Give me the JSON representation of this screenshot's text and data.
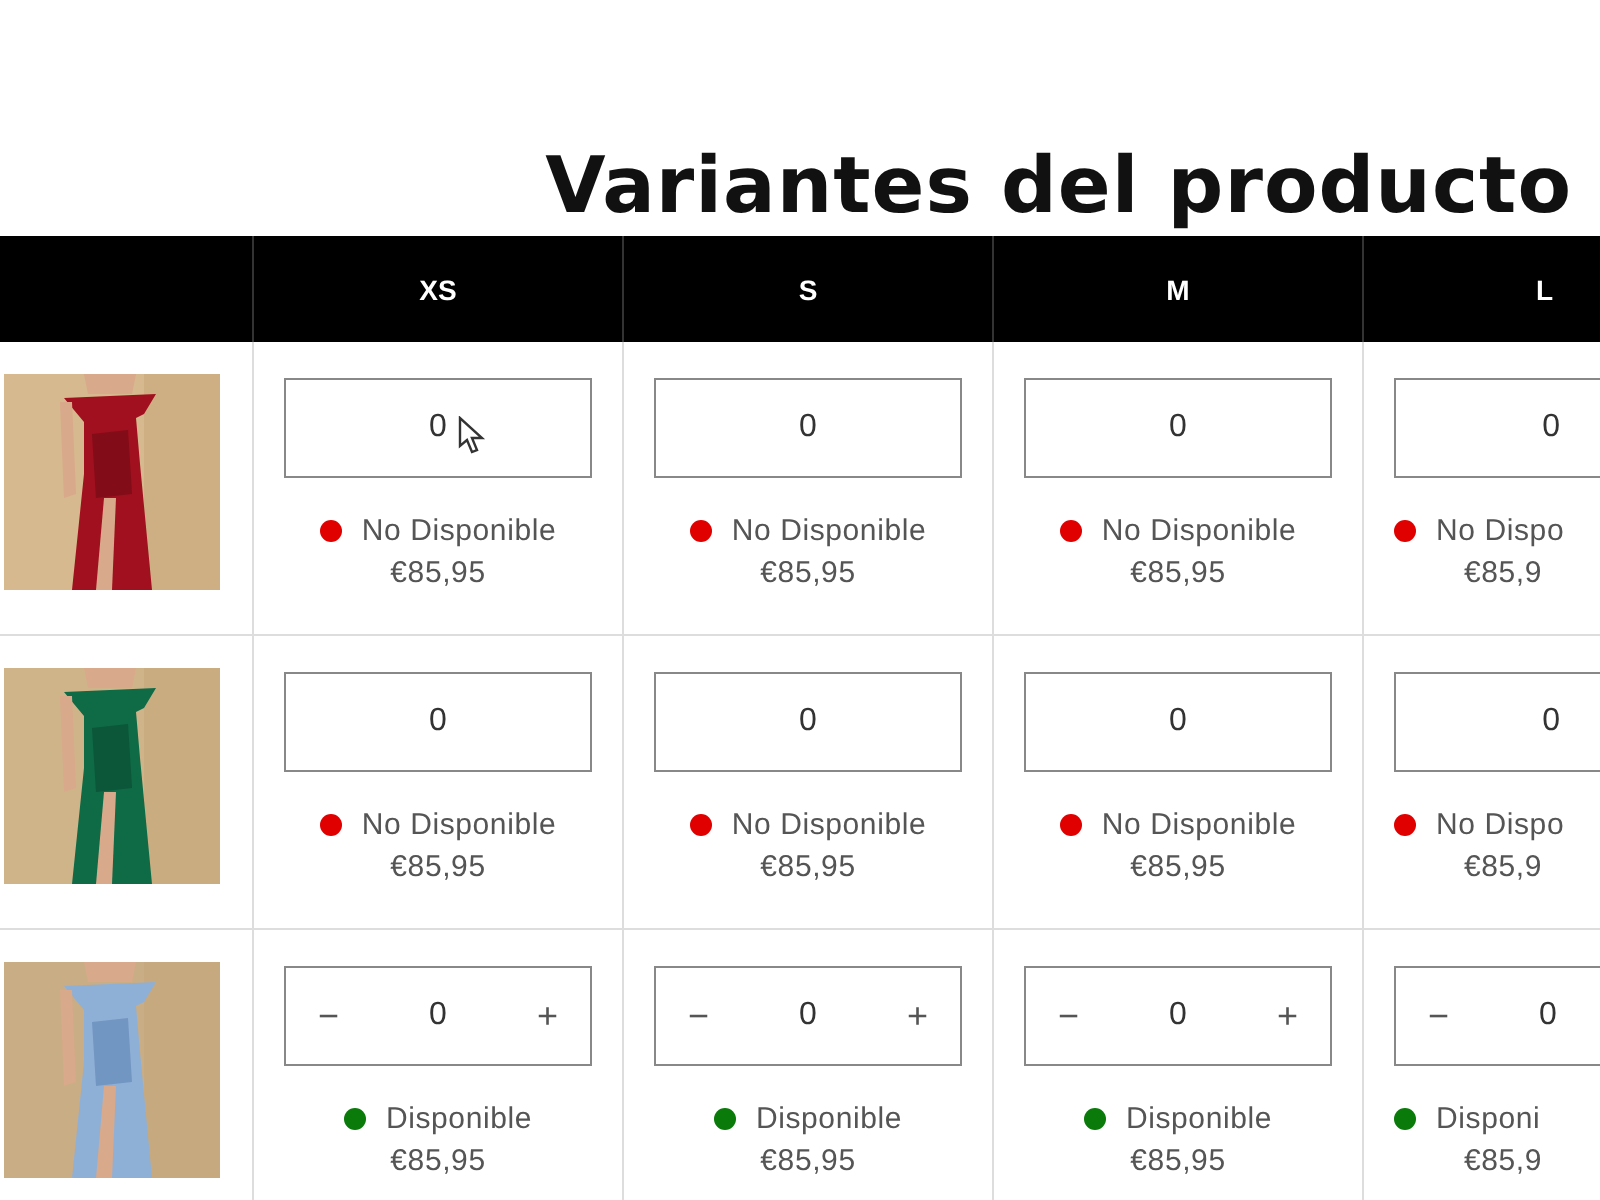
{
  "title": "Variantes del producto",
  "sizes": [
    "XS",
    "S",
    "M",
    "L"
  ],
  "rows": [
    {
      "cells": [
        {
          "quantity": "0",
          "available": false,
          "status": "No Disponible",
          "price": "€85,95"
        },
        {
          "quantity": "0",
          "available": false,
          "status": "No Disponible",
          "price": "€85,95"
        },
        {
          "quantity": "0",
          "available": false,
          "status": "No Disponible",
          "price": "€85,95"
        },
        {
          "quantity": "0",
          "available": false,
          "status": "No Dispo",
          "price": "€85,9"
        }
      ]
    },
    {
      "cells": [
        {
          "quantity": "0",
          "available": false,
          "status": "No Disponible",
          "price": "€85,95"
        },
        {
          "quantity": "0",
          "available": false,
          "status": "No Disponible",
          "price": "€85,95"
        },
        {
          "quantity": "0",
          "available": false,
          "status": "No Disponible",
          "price": "€85,95"
        },
        {
          "quantity": "0",
          "available": false,
          "status": "No Dispo",
          "price": "€85,9"
        }
      ]
    },
    {
      "cells": [
        {
          "quantity": "0",
          "available": true,
          "status": "Disponible",
          "price": "€85,95",
          "decrement": "−",
          "increment": "+"
        },
        {
          "quantity": "0",
          "available": true,
          "status": "Disponible",
          "price": "€85,95",
          "decrement": "−",
          "increment": "+"
        },
        {
          "quantity": "0",
          "available": true,
          "status": "Disponible",
          "price": "€85,95",
          "decrement": "−",
          "increment": "+"
        },
        {
          "quantity": "0",
          "available": true,
          "status": "Disponi",
          "price": "€85,9",
          "decrement": "−"
        }
      ]
    }
  ]
}
